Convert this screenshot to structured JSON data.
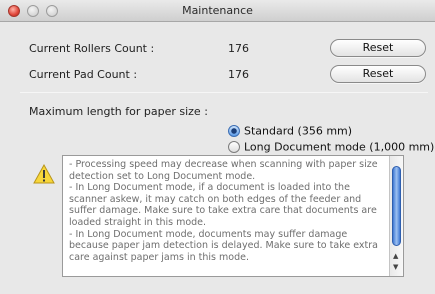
{
  "window": {
    "title": "Maintenance"
  },
  "counts": {
    "rollers_label": "Current Rollers Count :",
    "rollers_value": "176",
    "pad_label": "Current Pad Count :",
    "pad_value": "176",
    "reset_label": "Reset"
  },
  "paper_size": {
    "label": "Maximum length for paper size :",
    "options": [
      {
        "label": "Standard (356 mm)",
        "selected": true
      },
      {
        "label": "Long Document mode (1,000 mm)",
        "selected": false
      }
    ]
  },
  "notes": {
    "lines": [
      "- Processing speed may decrease when scanning with paper size detection set to Long Document mode.",
      "- In Long Document mode, if a document is loaded into the scanner askew, it may catch on both edges of the feeder and suffer damage. Make sure to take extra care that documents are loaded straight in this mode.",
      "- In Long Document mode, documents may suffer damage because paper jam detection is delayed. Make sure to take extra care against paper jams in this mode."
    ]
  },
  "colors": {
    "warning_yellow": "#f7d63a",
    "scroll_thumb": "#3f78d3",
    "close_button": "#e0463a"
  },
  "icons": {
    "warning": "warning-triangle-icon"
  }
}
